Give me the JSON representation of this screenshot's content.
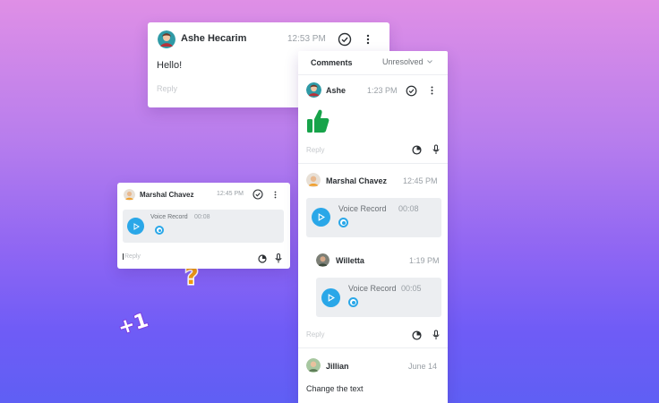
{
  "colors": {
    "accent": "#2aa7e8",
    "thumb": "#17a34a",
    "heart": "#ef5454",
    "question": "#f59e0b"
  },
  "card1": {
    "name": "Ashe Hecarim",
    "time": "12:53 PM",
    "message": "Hello!",
    "reply_placeholder": "Reply"
  },
  "card2": {
    "name": "Marshal Chavez",
    "time": "12:45 PM",
    "voice": {
      "title": "Voice Record",
      "duration": "00:08"
    },
    "reply_placeholder": "Reply"
  },
  "panel": {
    "title": "Comments",
    "filter": "Unresolved",
    "threads": [
      {
        "name": "Ashe",
        "time": "1:23 PM",
        "reply": "Reply"
      },
      {
        "name": "Marshal Chavez",
        "time": "12:45 PM",
        "voice": {
          "title": "Voice Record",
          "duration": "00:08"
        },
        "sub": {
          "name": "Willetta",
          "time": "1:19 PM",
          "voice": {
            "title": "Voice Record",
            "duration": "00:05"
          }
        },
        "reply": "Reply"
      },
      {
        "name": "Jillian",
        "time": "June 14",
        "text": "Change the text"
      }
    ]
  }
}
